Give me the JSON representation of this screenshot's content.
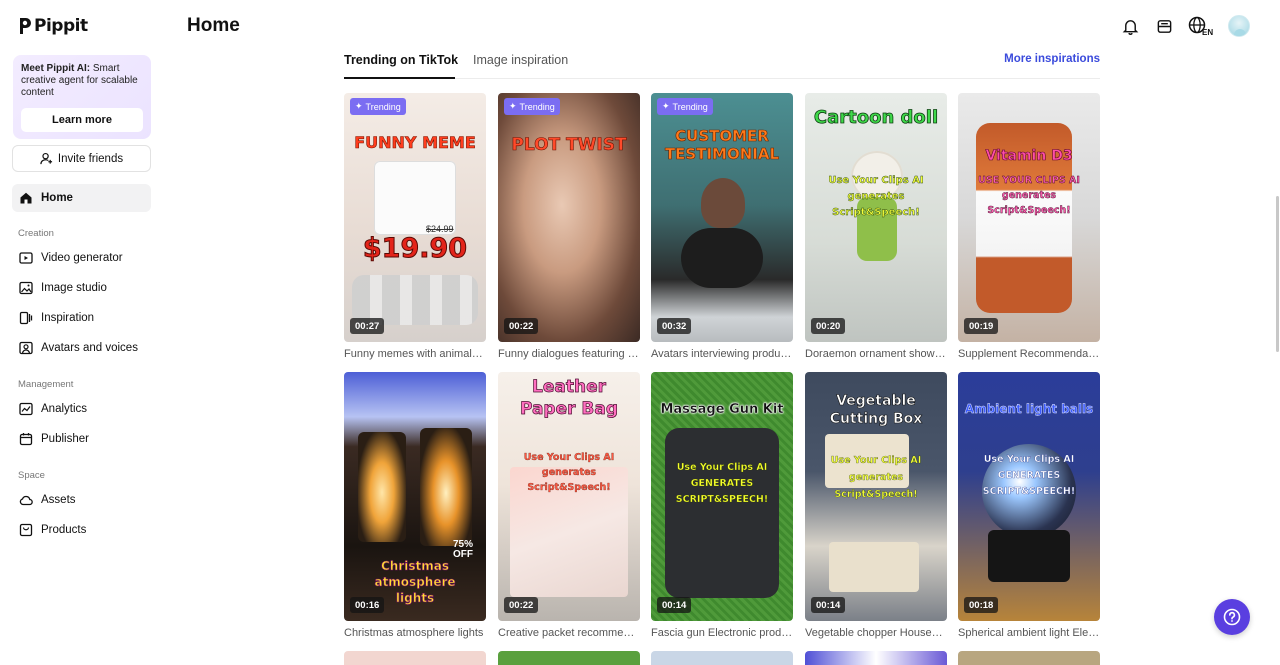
{
  "app": {
    "logo_text": "Pippit"
  },
  "sidebar": {
    "promo": {
      "bold": "Meet Pippit AI:",
      "text": " Smart creative agent for scalable content",
      "button": "Learn more"
    },
    "invite_label": "Invite friends",
    "home_label": "Home",
    "sections": [
      {
        "label": "Creation",
        "items": [
          "Video generator",
          "Image studio",
          "Inspiration",
          "Avatars and voices"
        ]
      },
      {
        "label": "Management",
        "items": [
          "Analytics",
          "Publisher"
        ]
      },
      {
        "label": "Space",
        "items": [
          "Assets",
          "Products"
        ]
      }
    ]
  },
  "header": {
    "title": "Home",
    "lang": "EN"
  },
  "tabs": {
    "items": [
      "Trending on TikTok",
      "Image inspiration"
    ],
    "more": "More inspirations"
  },
  "cards": [
    {
      "badge": "Trending",
      "overlay": "FUNNY MEME",
      "overlay2": "$19.90",
      "price_old": "$24.99",
      "duration": "00:27",
      "caption": "Funny memes with animals promoting products"
    },
    {
      "badge": "Trending",
      "overlay": "PLOT TWIST",
      "overlay2": "",
      "duration": "00:22",
      "caption": "Funny dialogues featuring product twists"
    },
    {
      "badge": "Trending",
      "overlay": "CUSTOMER TESTIMONIAL",
      "overlay2": "",
      "duration": "00:32",
      "caption": "Avatars interviewing product users"
    },
    {
      "badge": "",
      "overlay": "Cartoon doll",
      "overlay2": "Use Your Clips AI generates Script&Speech!",
      "duration": "00:20",
      "caption": "Doraemon ornament showcase video"
    },
    {
      "badge": "",
      "overlay": "Vitamin D3",
      "overlay2": "USE YOUR CLIPS AI generates Script&Speech!",
      "duration": "00:19",
      "caption": "Supplement Recommendation video"
    },
    {
      "badge": "",
      "overlay": "Christmas atmosphere lights",
      "overlay2": "75% OFF",
      "duration": "00:16",
      "caption": "Christmas atmosphere lights"
    },
    {
      "badge": "",
      "overlay": "Leather Paper Bag",
      "overlay2": "Use Your Clips AI generates Script&Speech!",
      "duration": "00:22",
      "caption": "Creative packet recommendation video"
    },
    {
      "badge": "",
      "overlay": "Massage Gun Kit",
      "overlay2": "Use Your Clips AI GENERATES SCRIPT&SPEECH!",
      "duration": "00:14",
      "caption": "Fascia gun Electronic products video"
    },
    {
      "badge": "",
      "overlay": "Vegetable Cutting Box",
      "overlay2": "Use Your Clips AI generates Script&Speech!",
      "duration": "00:14",
      "caption": "Vegetable chopper Household video"
    },
    {
      "badge": "",
      "overlay": "Ambient light balls",
      "overlay2": "Use Your Clips AI GENERATES SCRIPT&SPEECH!",
      "duration": "00:18",
      "caption": "Spherical ambient light Electronics video"
    }
  ],
  "colors": {
    "accent": "#5a3fe0",
    "link": "#3b4bdc",
    "badge": "#7b6df2"
  }
}
